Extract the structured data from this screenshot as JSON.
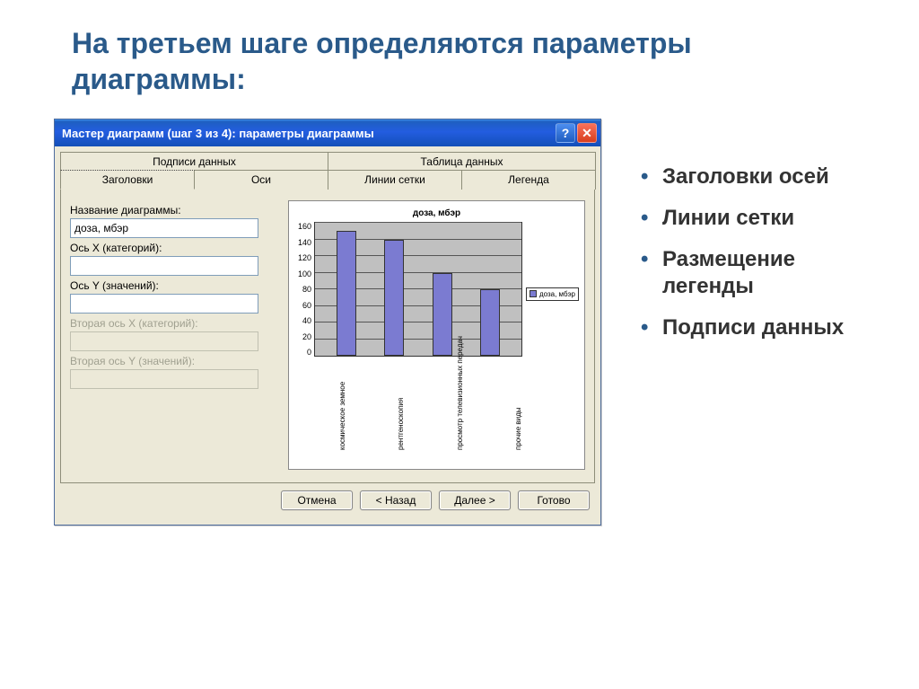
{
  "slide": {
    "title": "На третьем шаге определяются параметры диаграммы:"
  },
  "dialog": {
    "title": "Мастер диаграмм (шаг 3 из 4): параметры диаграммы",
    "tabs_top": [
      "Подписи данных",
      "Таблица данных"
    ],
    "tabs_bottom": [
      "Заголовки",
      "Оси",
      "Линии сетки",
      "Легенда"
    ],
    "fields": {
      "chart_title_label": "Название диаграммы:",
      "chart_title_value": "доза, мбэр",
      "axis_x_label": "Ось X (категорий):",
      "axis_x_value": "",
      "axis_y_label": "Ось Y (значений):",
      "axis_y_value": "",
      "axis_x2_label": "Вторая ось X (категорий):",
      "axis_y2_label": "Вторая ось Y (значений):"
    },
    "buttons": {
      "cancel": "Отмена",
      "back": "< Назад",
      "next": "Далее >",
      "finish": "Готово"
    }
  },
  "chart_data": {
    "type": "bar",
    "title": "доза, мбэр",
    "legend": "доза, мбэр",
    "categories": [
      "космическое земное",
      "рентгеноскопия",
      "просмотр телевизионных передач",
      "прочие виды"
    ],
    "values": [
      150,
      140,
      100,
      80
    ],
    "y_ticks": [
      0,
      20,
      40,
      60,
      80,
      100,
      120,
      140,
      160
    ],
    "ylim": [
      0,
      160
    ],
    "xlabel": "",
    "ylabel": ""
  },
  "bullets": [
    "Заголовки осей",
    "Линии сетки",
    "Размещение легенды",
    "Подписи данных"
  ]
}
